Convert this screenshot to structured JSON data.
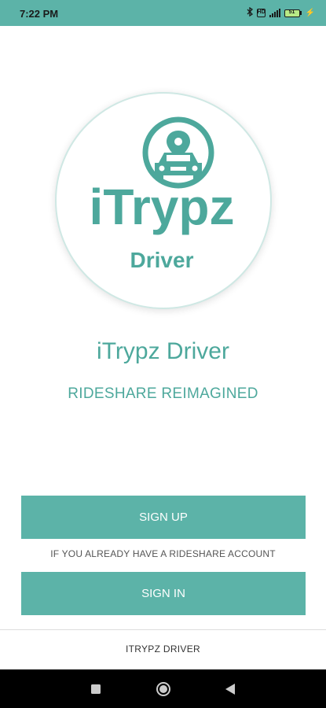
{
  "status_bar": {
    "time": "7:22 PM",
    "icons": [
      "bluetooth-icon",
      "hd-icon",
      "signal-icon",
      "battery-icon",
      "charging-icon"
    ],
    "hd_label": "HD",
    "battery_level": "51"
  },
  "logo": {
    "wordmark": "iTrypz",
    "subtitle": "Driver",
    "accent_color": "#5cb3a8"
  },
  "app_title": "iTrypz Driver",
  "tagline": "RIDESHARE REIMAGINED",
  "buttons": {
    "sign_up": "SIGN UP",
    "account_note": "IF YOU ALREADY HAVE A RIDESHARE ACCOUNT",
    "sign_in": "SIGN IN"
  },
  "footer": "ITRYPZ DRIVER",
  "nav_bar": {
    "icons": [
      "recents-icon",
      "home-icon",
      "back-icon"
    ]
  }
}
